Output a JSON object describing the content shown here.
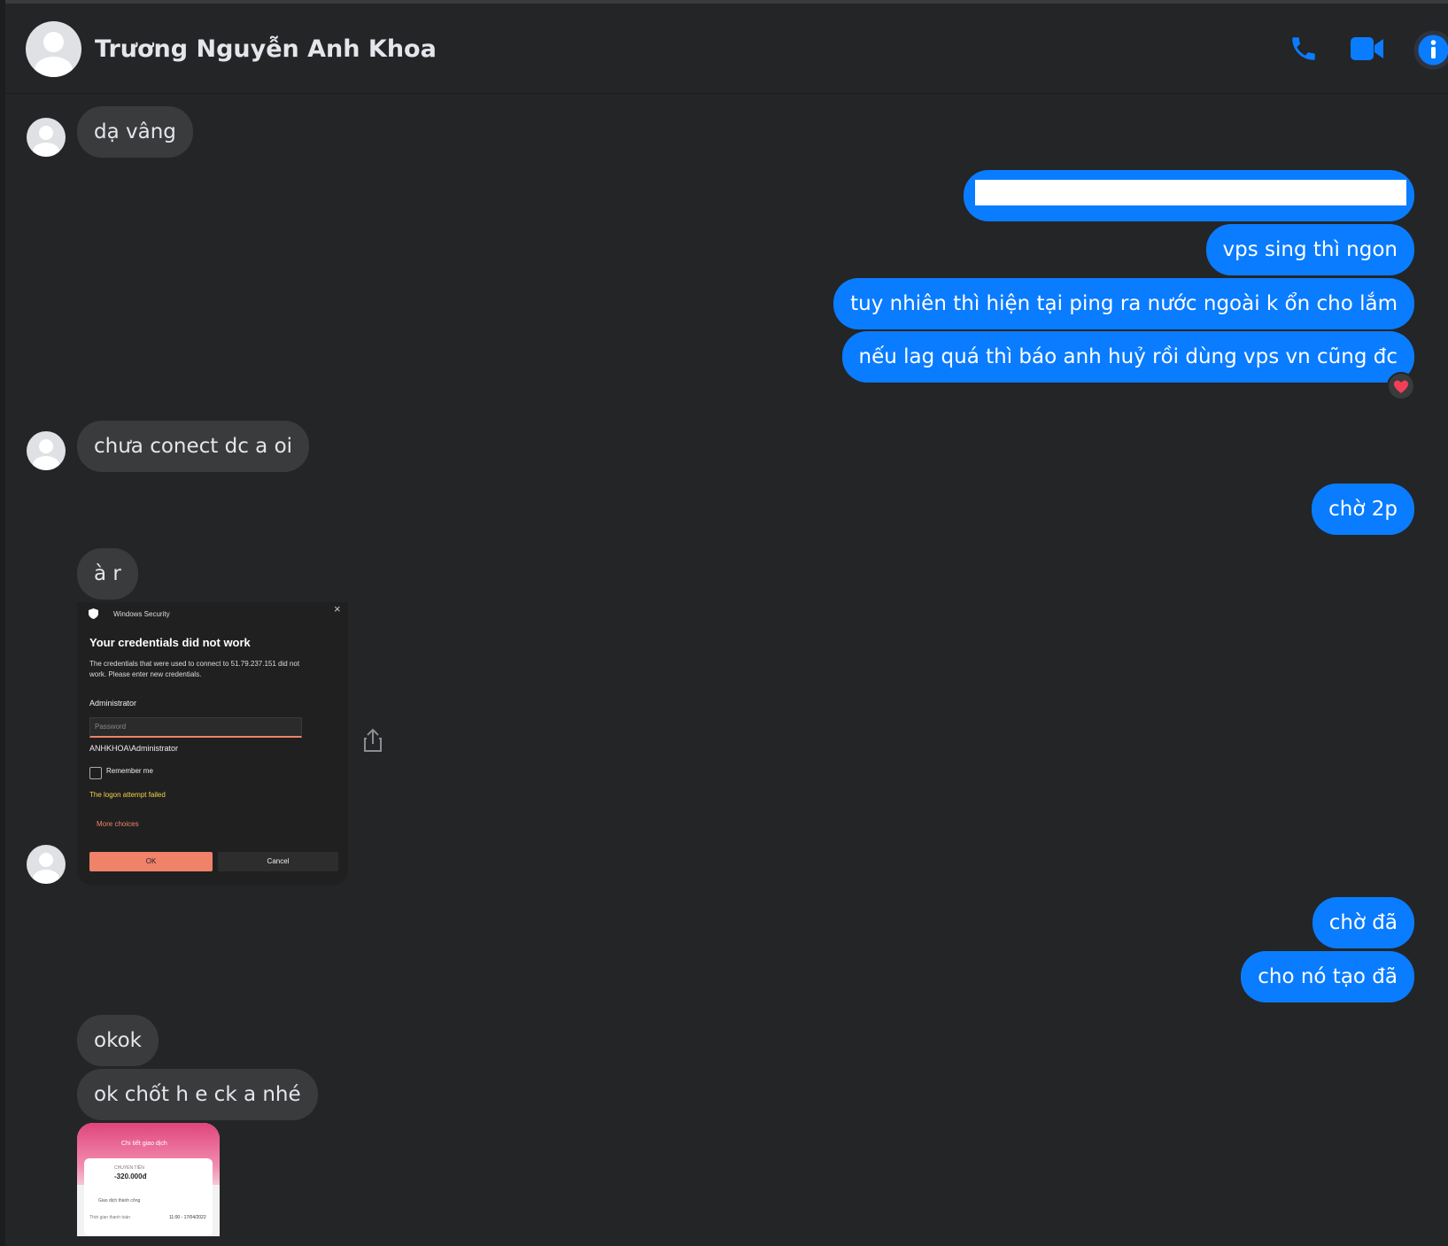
{
  "header": {
    "contact_name": "Trương Nguyễn Anh Khoa",
    "icons": [
      "phone-icon",
      "video-camera-icon",
      "info-icon"
    ],
    "accent_color": "#0a7cff"
  },
  "messages": {
    "m1": "dạ vâng",
    "m2": "",
    "m3": "vps sing thì ngon",
    "m4": "tuy nhiên thì hiện tại ping ra nước ngoài k ổn cho lắm",
    "m5": "nếu lag quá thì báo anh huỷ rồi dùng vps vn cũng đc",
    "m6": "chưa conect dc a oi",
    "m7": "chờ 2p",
    "m8": "à r",
    "m9": "chờ đã",
    "m10": "cho nó tạo đã",
    "m11": "okok",
    "m12": "ok chốt h e ck a nhé"
  },
  "reaction": "heart",
  "winsec": {
    "app_title": "Windows Security",
    "heading": "Your credentials did not work",
    "body_line1": "The credentials that were used to connect to 51.79.237.151 did not",
    "body_line2": "work. Please enter new credentials.",
    "username": "Administrator",
    "password_placeholder": "Password",
    "domain_user": "ANHKHOA\\Administrator",
    "remember_label": "Remember me",
    "error_text": "The logon attempt failed",
    "more_choices": "More choices",
    "ok_label": "OK",
    "cancel_label": "Cancel",
    "close_glyph": "×"
  },
  "receipt": {
    "title": "Chi tiết giao dịch",
    "tag": "CHUYỂN TIỀN",
    "amount": "-320.000đ",
    "status": "Giao dịch thành công",
    "time_label": "Thời gian thanh toán",
    "time_value": "11:00 - 17/04/2022"
  }
}
